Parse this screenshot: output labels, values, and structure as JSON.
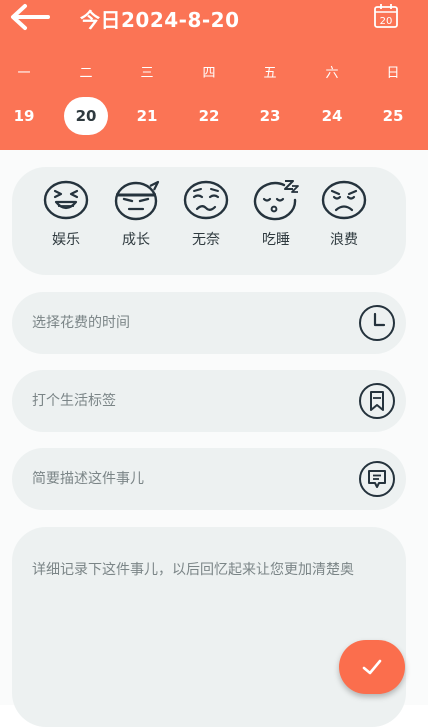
{
  "colors": {
    "accent": "#fb7455",
    "card": "#edf1f1",
    "icon_stroke": "#25333d",
    "placeholder": "#7b8587"
  },
  "header": {
    "back_icon": "arrow-left-icon",
    "title": "今日2024-8-20",
    "calendar_icon": "calendar-icon",
    "calendar_day": "20"
  },
  "week": {
    "weekdays": [
      "一",
      "二",
      "三",
      "四",
      "五",
      "六",
      "日"
    ],
    "dates": [
      "19",
      "20",
      "21",
      "22",
      "23",
      "24",
      "25"
    ],
    "selected": "20"
  },
  "moods": [
    {
      "label": "娱乐",
      "icon": "laughing-face-icon"
    },
    {
      "label": "成长",
      "icon": "ninja-face-icon"
    },
    {
      "label": "无奈",
      "icon": "helpless-face-icon"
    },
    {
      "label": "吃睡",
      "icon": "sleeping-face-icon"
    },
    {
      "label": "浪费",
      "icon": "angry-face-icon"
    }
  ],
  "fields": {
    "time": {
      "placeholder": "选择花费的时间",
      "icon": "clock-icon"
    },
    "tag": {
      "placeholder": "打个生活标签",
      "icon": "bookmark-icon"
    },
    "summary": {
      "placeholder": "简要描述这件事儿",
      "icon": "message-icon"
    }
  },
  "notes": {
    "placeholder": "详细记录下这件事儿，以后回忆起来让您更加清楚奥"
  },
  "submit": {
    "icon": "checkmark-icon"
  }
}
